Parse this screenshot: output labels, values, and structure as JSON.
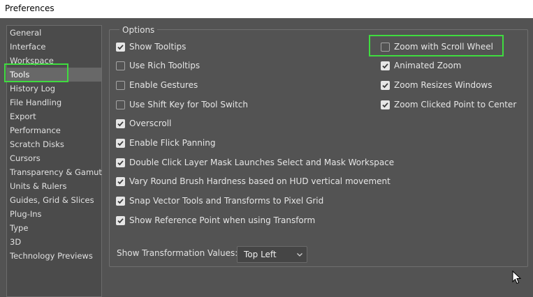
{
  "window": {
    "title": "Preferences"
  },
  "sidebar": {
    "items": [
      {
        "label": "General",
        "selected": false
      },
      {
        "label": "Interface",
        "selected": false
      },
      {
        "label": "Workspace",
        "selected": false
      },
      {
        "label": "Tools",
        "selected": true
      },
      {
        "label": "History Log",
        "selected": false
      },
      {
        "label": "File Handling",
        "selected": false
      },
      {
        "label": "Export",
        "selected": false
      },
      {
        "label": "Performance",
        "selected": false
      },
      {
        "label": "Scratch Disks",
        "selected": false
      },
      {
        "label": "Cursors",
        "selected": false
      },
      {
        "label": "Transparency & Gamut",
        "selected": false
      },
      {
        "label": "Units & Rulers",
        "selected": false
      },
      {
        "label": "Guides, Grid & Slices",
        "selected": false
      },
      {
        "label": "Plug-Ins",
        "selected": false
      },
      {
        "label": "Type",
        "selected": false
      },
      {
        "label": "3D",
        "selected": false
      },
      {
        "label": "Technology Previews",
        "selected": false
      }
    ]
  },
  "options": {
    "legend": "Options",
    "left": [
      {
        "label": "Show Tooltips",
        "checked": true
      },
      {
        "label": "Use Rich Tooltips",
        "checked": false
      },
      {
        "label": "Enable Gestures",
        "checked": false
      },
      {
        "label": "Use Shift Key for Tool Switch",
        "checked": false
      },
      {
        "label": "Overscroll",
        "checked": true
      },
      {
        "label": "Enable Flick Panning",
        "checked": true
      },
      {
        "label": "Double Click Layer Mask Launches Select and Mask Workspace",
        "checked": true
      },
      {
        "label": "Vary Round Brush Hardness based on HUD vertical movement",
        "checked": true
      },
      {
        "label": "Snap Vector Tools and Transforms to Pixel Grid",
        "checked": true
      },
      {
        "label": "Show Reference Point when using Transform",
        "checked": true
      }
    ],
    "right": [
      {
        "label": "Zoom with Scroll Wheel",
        "checked": false
      },
      {
        "label": "Animated Zoom",
        "checked": true
      },
      {
        "label": "Zoom Resizes Windows",
        "checked": true
      },
      {
        "label": "Zoom Clicked Point to Center",
        "checked": true
      }
    ]
  },
  "transformation": {
    "label": "Show Transformation Values:",
    "selected": "Top Left"
  },
  "colors": {
    "highlight": "#3fdc3f",
    "panel_bg": "#535353",
    "selected_item_bg": "#686868"
  }
}
